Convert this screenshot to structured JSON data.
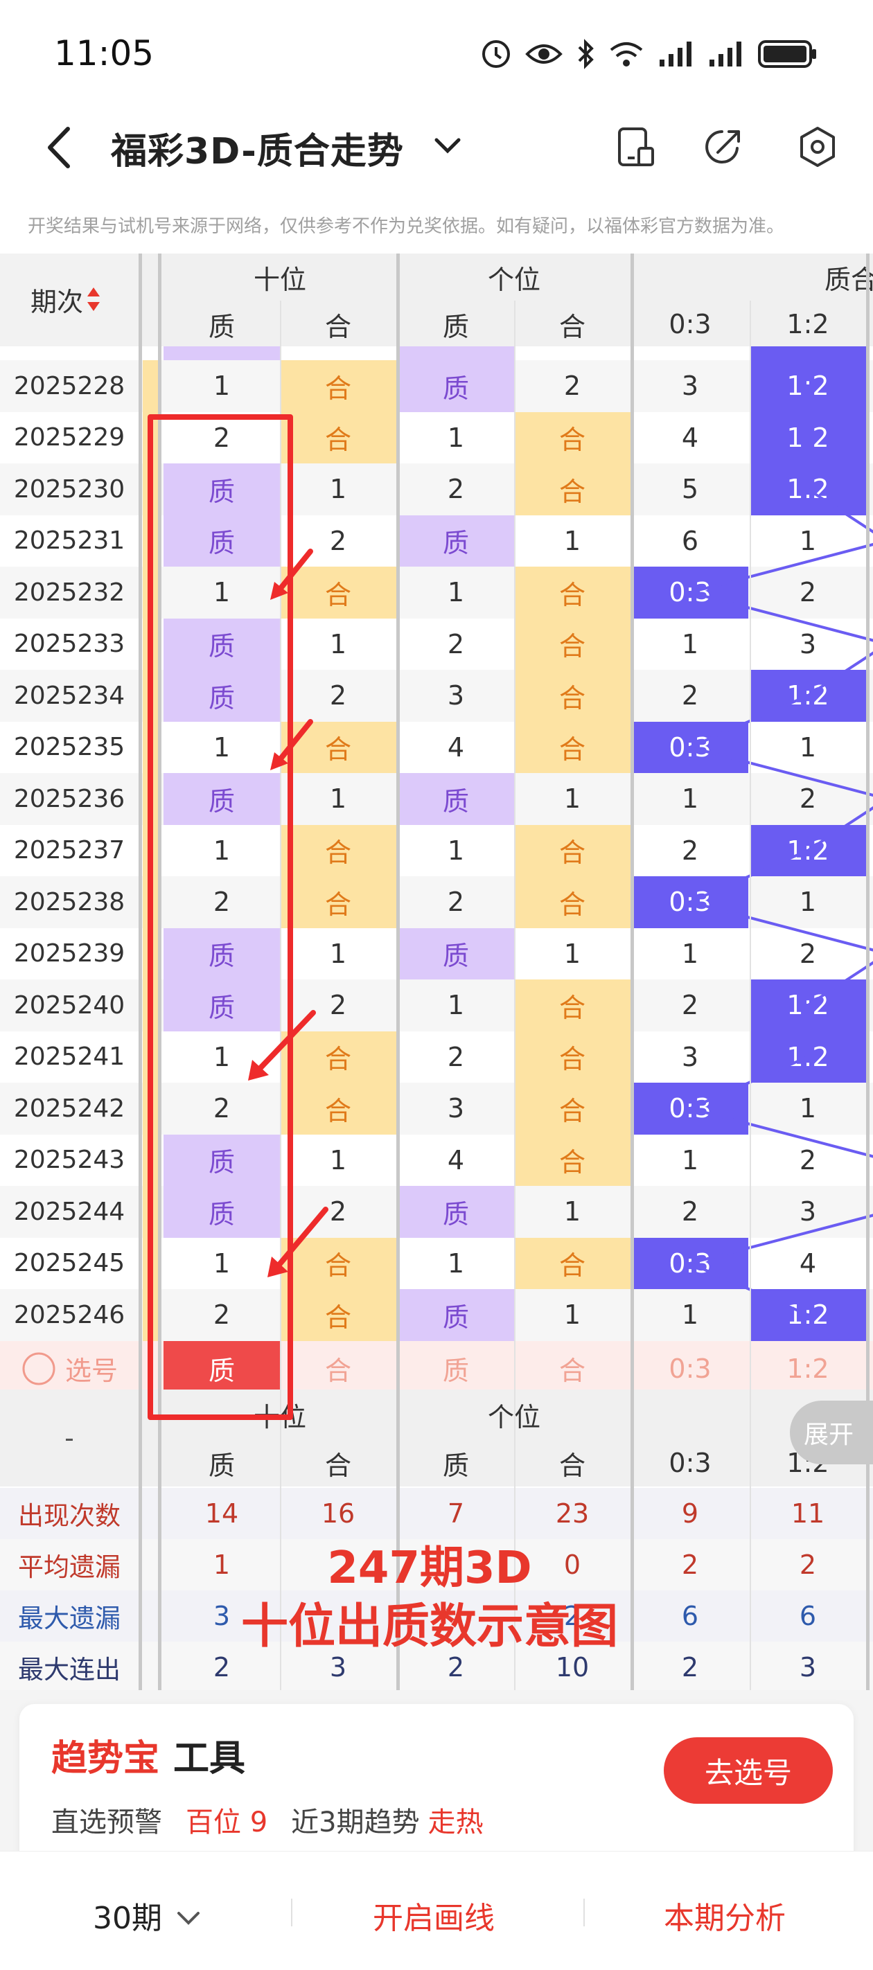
{
  "status_bar": {
    "time": "11:05"
  },
  "header": {
    "title": "福彩3D-质合走势"
  },
  "disclaimer": "开奖结果与试机号来源于网络，仅供参考不作为兑奖依据。如有疑问，以福体彩官方数据为准。",
  "table": {
    "period_header": "期次",
    "group_headers": [
      "十位",
      "个位",
      "质合"
    ],
    "sub_headers": [
      "质",
      "合",
      "质",
      "合",
      "0:3",
      "1:2"
    ],
    "rows": [
      {
        "period": "2025228",
        "cells": [
          "1",
          "合",
          "质",
          "2",
          "3",
          "1:2"
        ]
      },
      {
        "period": "2025229",
        "cells": [
          "2",
          "合",
          "1",
          "合",
          "4",
          "1:2"
        ]
      },
      {
        "period": "2025230",
        "cells": [
          "质",
          "1",
          "2",
          "合",
          "5",
          "1:2"
        ]
      },
      {
        "period": "2025231",
        "cells": [
          "质",
          "2",
          "质",
          "1",
          "6",
          "1"
        ]
      },
      {
        "period": "2025232",
        "cells": [
          "1",
          "合",
          "1",
          "合",
          "0:3",
          "2"
        ]
      },
      {
        "period": "2025233",
        "cells": [
          "质",
          "1",
          "2",
          "合",
          "1",
          "3"
        ]
      },
      {
        "period": "2025234",
        "cells": [
          "质",
          "2",
          "3",
          "合",
          "2",
          "1:2"
        ]
      },
      {
        "period": "2025235",
        "cells": [
          "1",
          "合",
          "4",
          "合",
          "0:3",
          "1"
        ]
      },
      {
        "period": "2025236",
        "cells": [
          "质",
          "1",
          "质",
          "1",
          "1",
          "2"
        ]
      },
      {
        "period": "2025237",
        "cells": [
          "1",
          "合",
          "1",
          "合",
          "2",
          "1:2"
        ]
      },
      {
        "period": "2025238",
        "cells": [
          "2",
          "合",
          "2",
          "合",
          "0:3",
          "1"
        ]
      },
      {
        "period": "2025239",
        "cells": [
          "质",
          "1",
          "质",
          "1",
          "1",
          "2"
        ]
      },
      {
        "period": "2025240",
        "cells": [
          "质",
          "2",
          "1",
          "合",
          "2",
          "1:2"
        ]
      },
      {
        "period": "2025241",
        "cells": [
          "1",
          "合",
          "2",
          "合",
          "3",
          "1:2"
        ]
      },
      {
        "period": "2025242",
        "cells": [
          "2",
          "合",
          "3",
          "合",
          "0:3",
          "1"
        ]
      },
      {
        "period": "2025243",
        "cells": [
          "质",
          "1",
          "4",
          "合",
          "1",
          "2"
        ]
      },
      {
        "period": "2025244",
        "cells": [
          "质",
          "2",
          "质",
          "1",
          "2",
          "3"
        ]
      },
      {
        "period": "2025245",
        "cells": [
          "1",
          "合",
          "1",
          "合",
          "0:3",
          "4"
        ]
      },
      {
        "period": "2025246",
        "cells": [
          "2",
          "合",
          "质",
          "1",
          "1",
          "1:2"
        ]
      }
    ],
    "select_row": {
      "label": "选号",
      "cells": [
        "质",
        "合",
        "质",
        "合",
        "0:3",
        "1:2"
      ]
    },
    "footer_dash": "-",
    "stats": [
      {
        "label": "出现次数",
        "values": [
          "14",
          "16",
          "7",
          "23",
          "9",
          "11"
        ],
        "color": "#c0392b"
      },
      {
        "label": "平均遗漏",
        "values": [
          "1",
          "",
          "",
          "0",
          "2",
          "2"
        ],
        "color": "#c0392b"
      },
      {
        "label": "最大遗漏",
        "values": [
          "3",
          "",
          "",
          "2",
          "6",
          "6"
        ],
        "color": "#2e5aac"
      },
      {
        "label": "最大连出",
        "values": [
          "2",
          "3",
          "2",
          "10",
          "2",
          "3"
        ],
        "color": "#2e3a6e"
      }
    ]
  },
  "annotation": {
    "line1": "247期3D",
    "line2": "十位出质数示意图"
  },
  "expand_button": "展开",
  "tool": {
    "title_a": "趋势宝",
    "title_b": "工具",
    "line_a": "直选预警",
    "line_b": "百位 9",
    "line_c": "近3期趋势",
    "line_d": "走热",
    "button": "去选号"
  },
  "bottom_bar": {
    "periods": "30期",
    "draw_line": "开启画线",
    "analysis": "本期分析"
  },
  "colors": {
    "purple": "#dcc9fa",
    "yellow": "#fde3a3",
    "blue": "#6a5cf2",
    "accent": "#e8372c"
  }
}
